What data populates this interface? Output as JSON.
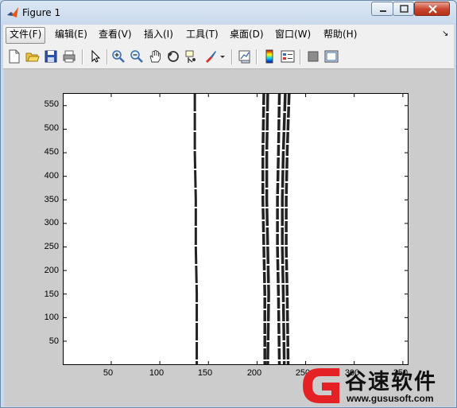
{
  "window": {
    "title": "Figure 1"
  },
  "menu": {
    "items": [
      {
        "label": "文件(F)",
        "key": "file"
      },
      {
        "label": "编辑(E)",
        "key": "edit"
      },
      {
        "label": "查看(V)",
        "key": "view"
      },
      {
        "label": "插入(I)",
        "key": "insert"
      },
      {
        "label": "工具(T)",
        "key": "tools"
      },
      {
        "label": "桌面(D)",
        "key": "desktop"
      },
      {
        "label": "窗口(W)",
        "key": "window"
      },
      {
        "label": "帮助(H)",
        "key": "help"
      }
    ]
  },
  "toolbar": {
    "icons": [
      "new-figure-icon",
      "open-file-icon",
      "save-icon",
      "print-icon",
      "pointer-icon",
      "zoom-in-icon",
      "zoom-out-icon",
      "pan-hand-icon",
      "rotate-3d-icon",
      "data-cursor-icon",
      "brush-icon",
      "brush-dropdown-icon",
      "link-plot-icon",
      "colorbar-icon",
      "legend-icon",
      "hide-plot-tools-icon",
      "show-plot-tools-icon"
    ]
  },
  "axes": {
    "xticks": [
      "50",
      "100",
      "150",
      "200",
      "250",
      "300",
      "350"
    ],
    "yticks": [
      "550",
      "500",
      "450",
      "400",
      "350",
      "300",
      "250",
      "200",
      "150",
      "100",
      "50"
    ]
  },
  "chart_data": {
    "type": "line",
    "xlim": [
      1,
      355
    ],
    "ylim": [
      1,
      575
    ],
    "grid": false,
    "series": [
      {
        "x": [
          136,
          136,
          137,
          137,
          138,
          138
        ],
        "y": [
          575,
          450,
          350,
          250,
          150,
          1
        ]
      },
      {
        "x": [
          207,
          206,
          206,
          207,
          208,
          208
        ],
        "y": [
          575,
          450,
          350,
          250,
          150,
          1
        ]
      },
      {
        "x": [
          211,
          210,
          210,
          211,
          212,
          211
        ],
        "y": [
          575,
          450,
          350,
          250,
          150,
          1
        ]
      },
      {
        "x": [
          223,
          222,
          221,
          221,
          222,
          223
        ],
        "y": [
          575,
          450,
          350,
          250,
          150,
          1
        ]
      },
      {
        "x": [
          229,
          227,
          226,
          226,
          227,
          228
        ],
        "y": [
          575,
          450,
          350,
          250,
          150,
          1
        ]
      },
      {
        "x": [
          233,
          231,
          230,
          230,
          231,
          232
        ],
        "y": [
          575,
          450,
          350,
          250,
          150,
          1
        ]
      }
    ]
  },
  "watermark": {
    "text": "谷速软件",
    "url": "www.gususoft.com"
  }
}
